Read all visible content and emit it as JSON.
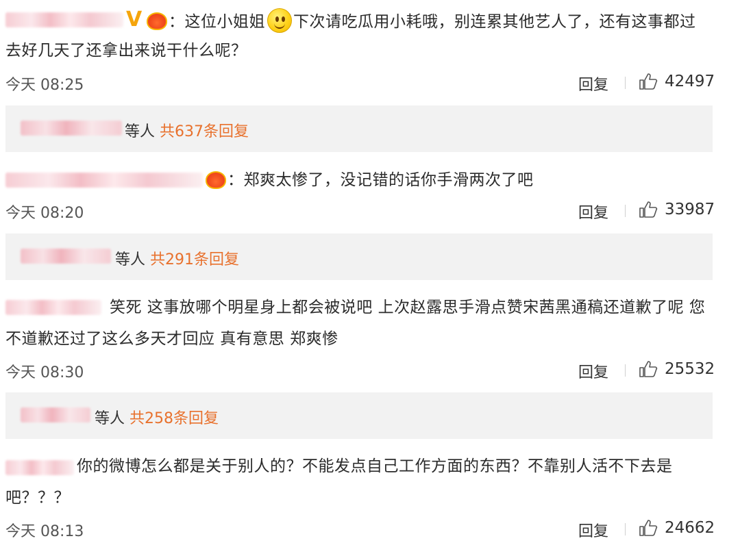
{
  "comments": [
    {
      "text_line1_a": "：这位小姐姐",
      "text_line1_b": "下次请吃瓜用小耗哦，别连累其他艺人了，还有这事都过",
      "text_line2": "去好几天了还拿出来说干什么呢？",
      "time": "今天 08:25",
      "reply_label": "回复",
      "likes": "42497",
      "badges": [
        "vip-v",
        "crown",
        "smiley"
      ]
    },
    {
      "text_line1": "：郑爽太惨了，没记错的话你手滑两次了吧",
      "time": "今天 08:20",
      "reply_label": "回复",
      "likes": "33987",
      "badges": [
        "crown"
      ]
    },
    {
      "text_line1": "笑死 这事放哪个明星身上都会被说吧 上次赵露思手滑点赞宋茜黑通稿还道歉了呢 您",
      "text_line2": "不道歉还过了这么多天才回应 真有意思 郑爽惨",
      "time": "今天 08:30",
      "reply_label": "回复",
      "likes": "25532"
    },
    {
      "text_line1": "你的微博怎么都是关于别人的？不能发点自己工作方面的东西？不靠别人活不下去是",
      "text_line2": "吧？？？",
      "time": "今天 08:13",
      "reply_label": "回复",
      "likes": "24662"
    }
  ],
  "reply_summaries": [
    {
      "prefix": "等人 ",
      "count": "共637条回复"
    },
    {
      "prefix": "等人 ",
      "count": "共291条回复"
    },
    {
      "prefix": "等人 ",
      "count": "共258条回复"
    }
  ],
  "colors": {
    "accent": "#e8712d",
    "vip": "#f5a50c",
    "crown": "#f24e1e",
    "bar_bg": "#f2f2f2"
  }
}
